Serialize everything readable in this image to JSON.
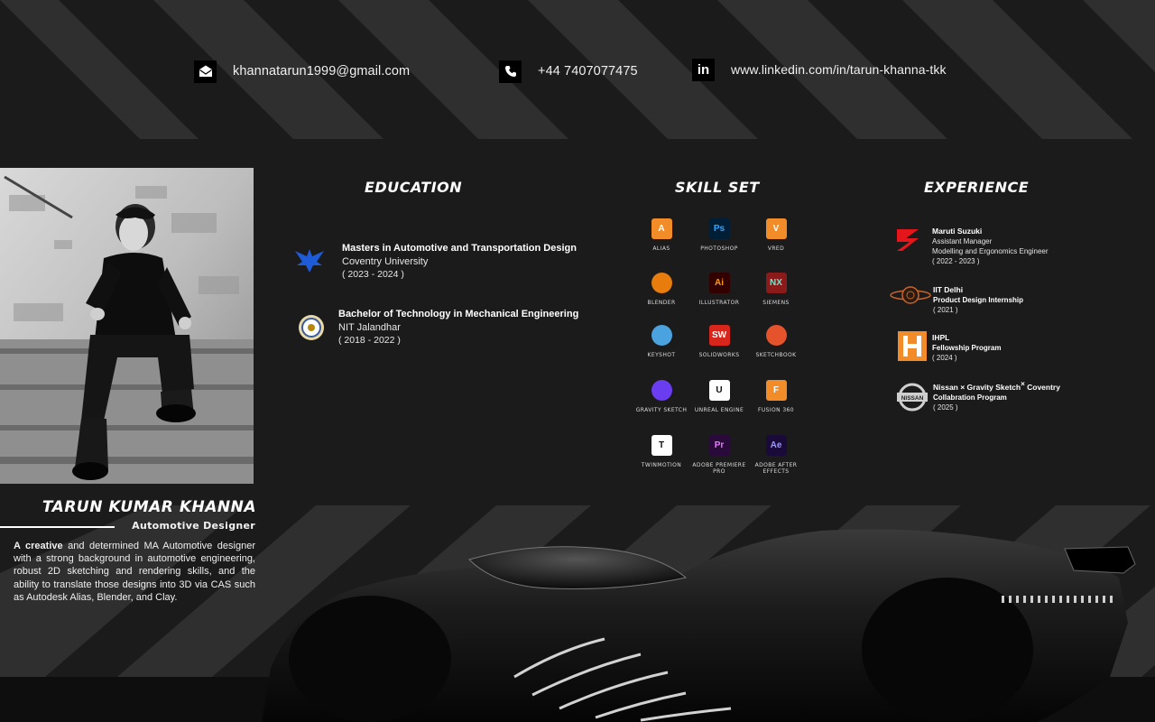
{
  "contact": {
    "email": "khannatarun1999@gmail.com",
    "phone": "+44 7407077475",
    "linkedin": "www.linkedin.com/in/tarun-khanna-tkk"
  },
  "profile": {
    "name": "TARUN KUMAR KHANNA",
    "role": "Automotive Designer",
    "bio_lead": "A creative",
    "bio_rest": " and determined MA Automotive designer with a strong background in automotive engineering, robust 2D sketching and rendering skills, and the ability to translate those designs into 3D via CAS such as Autodesk Alias, Blender, and Clay."
  },
  "education": {
    "heading": "EDUCATION",
    "items": [
      {
        "degree": "Masters in Automotive and Transportation Design",
        "institution": "Coventry University",
        "years": "( 2023 - 2024 )"
      },
      {
        "degree": "Bachelor of Technology in Mechanical Engineering",
        "institution": "NIT Jalandhar",
        "years": "( 2018 - 2022 )"
      }
    ]
  },
  "skills": {
    "heading": "SKILL SET",
    "items": [
      {
        "label": "ALIAS",
        "icon_text": "A",
        "color": "#f28c28",
        "text_color": "#ffffff"
      },
      {
        "label": "PHOTOSHOP",
        "icon_text": "Ps",
        "color": "#001e36",
        "text_color": "#31a8ff"
      },
      {
        "label": "VRED",
        "icon_text": "V",
        "color": "#f28c28",
        "text_color": "#ffffff"
      },
      {
        "label": "BLENDER",
        "icon_text": "",
        "color": "#e87d0d",
        "text_color": "#ffffff"
      },
      {
        "label": "ILLUSTRATOR",
        "icon_text": "Ai",
        "color": "#330000",
        "text_color": "#ff9a00"
      },
      {
        "label": "SIEMENS",
        "icon_text": "NX",
        "color": "#8b1a1a",
        "text_color": "#7fe0c8"
      },
      {
        "label": "KEYSHOT",
        "icon_text": "",
        "color": "#4aa3df",
        "text_color": "#ffffff"
      },
      {
        "label": "SOLIDWORKS",
        "icon_text": "SW",
        "color": "#d8261c",
        "text_color": "#ffffff"
      },
      {
        "label": "SKETCHBOOK",
        "icon_text": "",
        "color": "#e5532d",
        "text_color": "#ffffff"
      },
      {
        "label": "GRAVITY SKETCH",
        "icon_text": "",
        "color": "#6a3df0",
        "text_color": "#ffffff"
      },
      {
        "label": "UNREAL ENGINE",
        "icon_text": "U",
        "color": "#ffffff",
        "text_color": "#111111"
      },
      {
        "label": "FUSION 360",
        "icon_text": "F",
        "color": "#f28c28",
        "text_color": "#ffffff"
      },
      {
        "label": "TWINMOTION",
        "icon_text": "T",
        "color": "#ffffff",
        "text_color": "#111111"
      },
      {
        "label": "ADOBE PREMIERE PRO",
        "icon_text": "Pr",
        "color": "#2a0a3a",
        "text_color": "#ea77ff"
      },
      {
        "label": "ADOBE AFTER EFFECTS",
        "icon_text": "Ae",
        "color": "#1a0a3a",
        "text_color": "#9999ff"
      }
    ]
  },
  "experience": {
    "heading": "EXPERIENCE",
    "items": [
      {
        "company": "Maruti Suzuki",
        "title": "Assistant Manager",
        "detail": "Modelling and Ergonomics Engineer",
        "years": "( 2022 - 2023 )",
        "logo": "suzuki-logo"
      },
      {
        "company": "IIT Delhi",
        "title": "Product Design Internship",
        "years": "( 2021 )",
        "logo": "iit-delhi-logo"
      },
      {
        "company": "IHPL",
        "title": "Fellowship Program",
        "years": "( 2024 )",
        "logo": "ihpl-logo"
      },
      {
        "company": "Nissan × Gravity Sketch",
        "company_sup": "×",
        "company_tail": " Coventry",
        "title": "Collabration Program",
        "years": "( 2025 )",
        "logo": "nissan-logo"
      }
    ]
  }
}
